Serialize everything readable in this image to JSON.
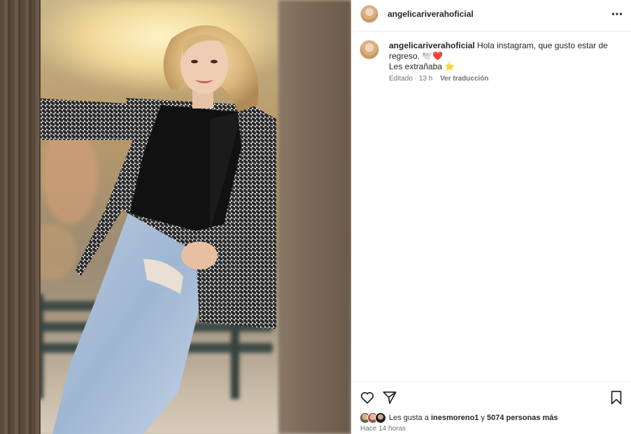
{
  "post": {
    "username": "angelicariverahoficial",
    "photo_alt": "Mujer con blazer de pata de gallo y jeans apoyada en un árbol"
  },
  "header": {
    "username": "angelicariverahoficial",
    "more_icon": "more-dots-icon"
  },
  "caption": {
    "username": "angelicariverahoficial",
    "text_line1": " Hola instagram, que gusto estar de regreso. 🕊️❤️",
    "text_line2": "Les extrañaba ⭐",
    "edited": "Editado",
    "separator": " · ",
    "age": "13 h",
    "translate": "Ver traducción"
  },
  "actions": {
    "like_icon": "heart-icon",
    "share_icon": "send-icon",
    "save_icon": "bookmark-icon"
  },
  "likes": {
    "prefix": "Les gusta a ",
    "user": "inesmoreno1",
    "connector": " y ",
    "others": "5074 personas más"
  },
  "timestamp": "Hace 14 horas",
  "colors": {
    "text": "#262626",
    "secondary": "#737373",
    "divider": "#efefef",
    "heart_red": "#ed4956"
  }
}
